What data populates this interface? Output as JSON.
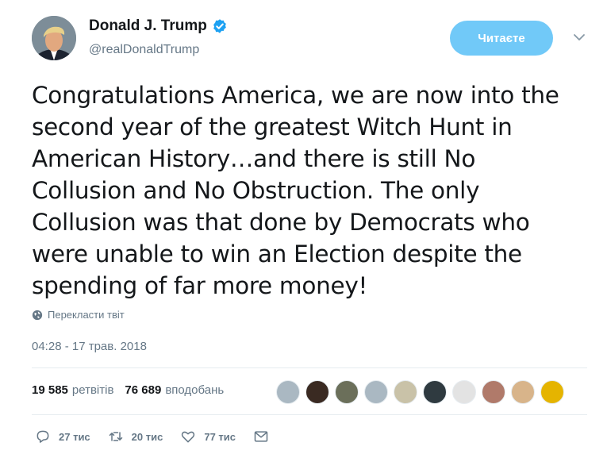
{
  "user": {
    "display_name": "Donald J. Trump",
    "handle": "@realDonaldTrump",
    "verified": true
  },
  "follow_button": {
    "label": "Читаєте"
  },
  "tweet": {
    "lines": [
      "Congratulations America, we are now into the",
      "second year of the greatest Witch Hunt in",
      "American History…and there is still No",
      "Collusion and No Obstruction. The only",
      "Collusion was that done by Democrats who",
      "were unable to win an Election despite the",
      "spending of far more money!"
    ],
    "translate_label": "Перекласти твіт",
    "timestamp": "04:28 - 17 трав. 2018"
  },
  "stats": {
    "retweets_count": "19 585",
    "retweets_label": "ретвітів",
    "likes_count": "76 689",
    "likes_label": "вподобань"
  },
  "likers": [
    {
      "name": "liker-avatar-1",
      "color": "#aab8c2"
    },
    {
      "name": "liker-avatar-2",
      "color": "#3a2a22"
    },
    {
      "name": "liker-avatar-3",
      "color": "#6b6f5a"
    },
    {
      "name": "liker-avatar-4",
      "color": "#aab8c2"
    },
    {
      "name": "liker-avatar-5",
      "color": "#c9c2a8"
    },
    {
      "name": "liker-avatar-6",
      "color": "#2f3a40"
    },
    {
      "name": "liker-avatar-7",
      "color": "#e3e3e3"
    },
    {
      "name": "liker-avatar-8",
      "color": "#b07a6a"
    },
    {
      "name": "liker-avatar-9",
      "color": "#d8b48a"
    },
    {
      "name": "liker-avatar-10",
      "color": "#e5b400"
    }
  ],
  "actions": {
    "reply_count": "27 тис",
    "retweet_count": "20 тис",
    "like_count": "77 тис",
    "icons": [
      "reply-icon",
      "retweet-icon",
      "heart-icon",
      "direct-message-icon"
    ]
  },
  "colors": {
    "follow_button_bg": "#71c9f8",
    "verified_badge": "#1da1f2",
    "muted_text": "#657786",
    "divider": "#e6ecf0"
  }
}
